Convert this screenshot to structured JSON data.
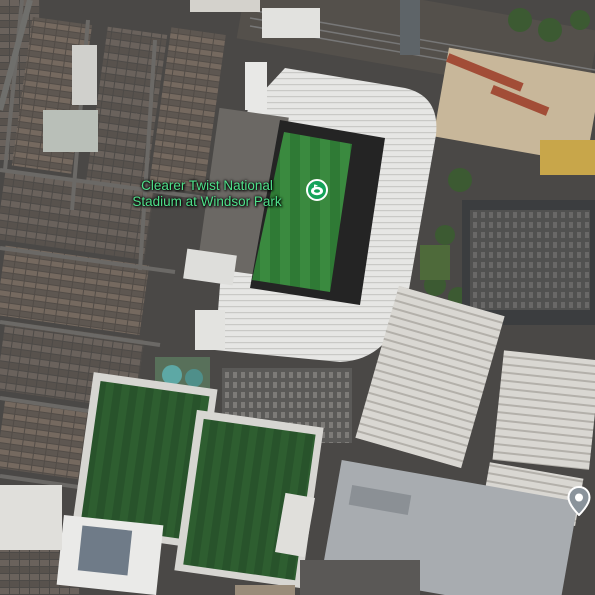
{
  "map": {
    "view": "satellite",
    "poi": {
      "name_line1": "Clearer Twist National",
      "name_line2": "Stadium at Windsor Park",
      "label_color": "#4fe08a",
      "pin_color": "#16a35a",
      "icon": "stadium-icon"
    },
    "location_marker": {
      "icon": "map-pin-icon",
      "color": "#8a939b"
    }
  }
}
